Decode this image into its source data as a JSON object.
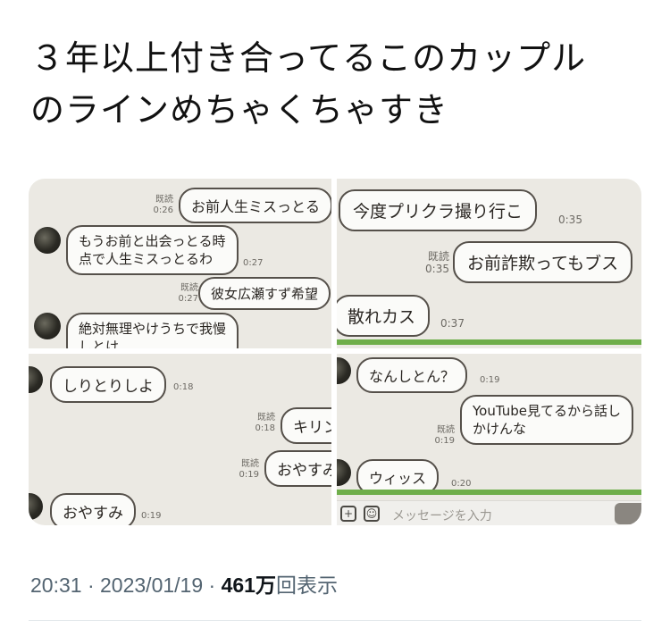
{
  "tweet": {
    "text_line1": "３年以上付き合ってるこのカップル",
    "text_line2": "のラインめちゃくちゃすき"
  },
  "panels": {
    "p1": {
      "m1": {
        "read": "既読",
        "time": "0:26",
        "text": "お前人生ミスっとる"
      },
      "m2": {
        "line1": "もうお前と出会っとる時",
        "line2": "点で人生ミスっとるわ",
        "time": "0:27"
      },
      "m3": {
        "read": "既読",
        "time": "0:27",
        "text": "彼女広瀬すず希望"
      },
      "m4": {
        "line1": "絶対無理やけうちで我慢",
        "line2": "しとけ"
      }
    },
    "p2": {
      "m1": {
        "text": "今度プリクラ撮り行こ",
        "time": "0:35"
      },
      "m2": {
        "read": "既読",
        "time": "0:35",
        "text": "お前詐欺ってもブス"
      },
      "m3": {
        "text": "散れカス",
        "time": "0:37"
      }
    },
    "p3": {
      "m1": {
        "text": "しりとりしよ",
        "time": "0:18"
      },
      "m2": {
        "read": "既読",
        "time": "0:18",
        "text": "キリン"
      },
      "m3": {
        "read": "既読",
        "time": "0:19",
        "text": "おやすみ"
      },
      "m4": {
        "text": "おやすみ",
        "time": "0:19"
      }
    },
    "p4": {
      "m1": {
        "text": "なんしとん？",
        "time": "0:19"
      },
      "m2": {
        "read": "既読",
        "time": "0:19",
        "line1": "YouTube見てるから話し",
        "line2": "かけんな"
      },
      "m3": {
        "text": "ウィッス",
        "time": "0:20"
      },
      "input_placeholder": "メッセージを入力"
    }
  },
  "footer": {
    "time": "20:31",
    "sep1": " · ",
    "date": "2023/01/19",
    "sep2": " · ",
    "views": "461万",
    "views_label": "回表示"
  },
  "colors": {
    "chat_bg": "#ebe9e3",
    "line_green": "#6fae4a",
    "meta_gray": "#536471"
  }
}
